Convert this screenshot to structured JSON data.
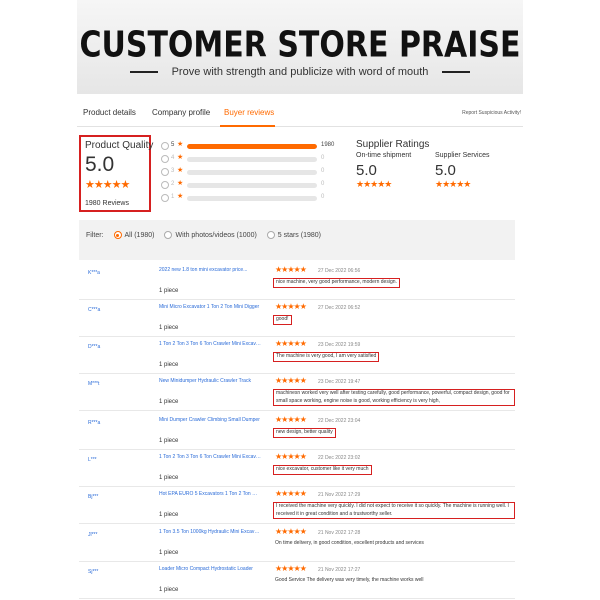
{
  "header": {
    "title": "CUSTOMER STORE PRAISE",
    "subtitle": "Prove with strength and publicize with word of mouth"
  },
  "tabs": {
    "product_details": "Product details",
    "company_profile": "Company profile",
    "buyer_reviews": "Buyer reviews",
    "report": "Report Suspicious Activity!"
  },
  "product_quality": {
    "label": "Product Quality",
    "score": "5.0",
    "stars": "★★★★★",
    "reviews": "1980 Reviews"
  },
  "rating_bars": [
    {
      "stars": "5",
      "count": "1980",
      "fraction": 1.0
    },
    {
      "stars": "4",
      "count": "0",
      "fraction": 0
    },
    {
      "stars": "3",
      "count": "0",
      "fraction": 0
    },
    {
      "stars": "2",
      "count": "0",
      "fraction": 0
    },
    {
      "stars": "1",
      "count": "0",
      "fraction": 0
    }
  ],
  "supplier": {
    "heading": "Supplier Ratings",
    "ontime_label": "On-time shipment",
    "ontime_value": "5.0",
    "services_label": "Supplier Services",
    "services_value": "5.0",
    "stars": "★★★★★"
  },
  "filter": {
    "label": "Filter:",
    "options": [
      "All (1980)",
      "With photos/videos (1000)",
      "5 stars (1980)"
    ],
    "selected": 0
  },
  "reviews": [
    {
      "user": "K***a",
      "product": "2022 new 1.8 ton mini excavator price...",
      "qty": "1 piece",
      "stars": "★★★★★",
      "date": "27 Dec 2022 06:56",
      "comment": "nice machine, very good performance, modern design.",
      "boxed": true
    },
    {
      "user": "C***a",
      "product": "Mini Micro Excavator 1 Ton 2 Ton Mini Digger",
      "qty": "1 piece",
      "stars": "★★★★★",
      "date": "27 Dec 2022 06:52",
      "comment": "good!",
      "boxed": true
    },
    {
      "user": "D***a",
      "product": "1 Ton 2 Ton 3 Ton 6 Ton Crawler Mini Excavator",
      "qty": "1 piece",
      "stars": "★★★★★",
      "date": "23 Dec 2022 19:59",
      "comment": "The machine is very good, I am very satisfied",
      "boxed": true
    },
    {
      "user": "M***t",
      "product": "New Minidumper Hydraulic Crawler Track",
      "qty": "1 piece",
      "stars": "★★★★★",
      "date": "23 Dec 2022 19:47",
      "comment": "machinesn worked very well after testing carefully, good performance, powerful, compact design, good for small space working, engine noise is good, working efficiency is very high,",
      "boxed": true
    },
    {
      "user": "R***a",
      "product": "Mini Dumper Crawler Climbing Small Dumper",
      "qty": "1 piece",
      "stars": "★★★★★",
      "date": "22 Dec 2022 23:04",
      "comment": "new design, better quality",
      "boxed": true
    },
    {
      "user": "L***",
      "product": "1 Ton 2 Ton 3 Ton 6 Ton Crawler Mini Excavator",
      "qty": "1 piece",
      "stars": "★★★★★",
      "date": "22 Dec 2022 23:02",
      "comment": "nice excavator, customer like it very much",
      "boxed": true
    },
    {
      "user": "Bj***",
      "product": "Hot EPA EURO 5 Excavators 1 Ton 2 Ton Mini",
      "qty": "1 piece",
      "stars": "★★★★★",
      "date": "21 Nov 2022 17:29",
      "comment": "I received the machine very quickly. I did not expect to receive it so quickly. The machine is running well. I received it in great condition and a trustworthy seller.",
      "boxed": true
    },
    {
      "user": "Jl***",
      "product": "1 Ton 3.5 Ton 1000kg Hydraulic Mini Excavator",
      "qty": "1 piece",
      "stars": "★★★★★",
      "date": "21 Nov 2022 17:28",
      "comment": "On time delivery, in good condition, excellent products and services",
      "boxed": false
    },
    {
      "user": "Sj***",
      "product": "Loader Micro Compact Hydrostatic Loader",
      "qty": "1 piece",
      "stars": "★★★★★",
      "date": "21 Nov 2022 17:27",
      "comment": "Good Service The delivery was very timely, the machine works well",
      "boxed": false
    }
  ]
}
